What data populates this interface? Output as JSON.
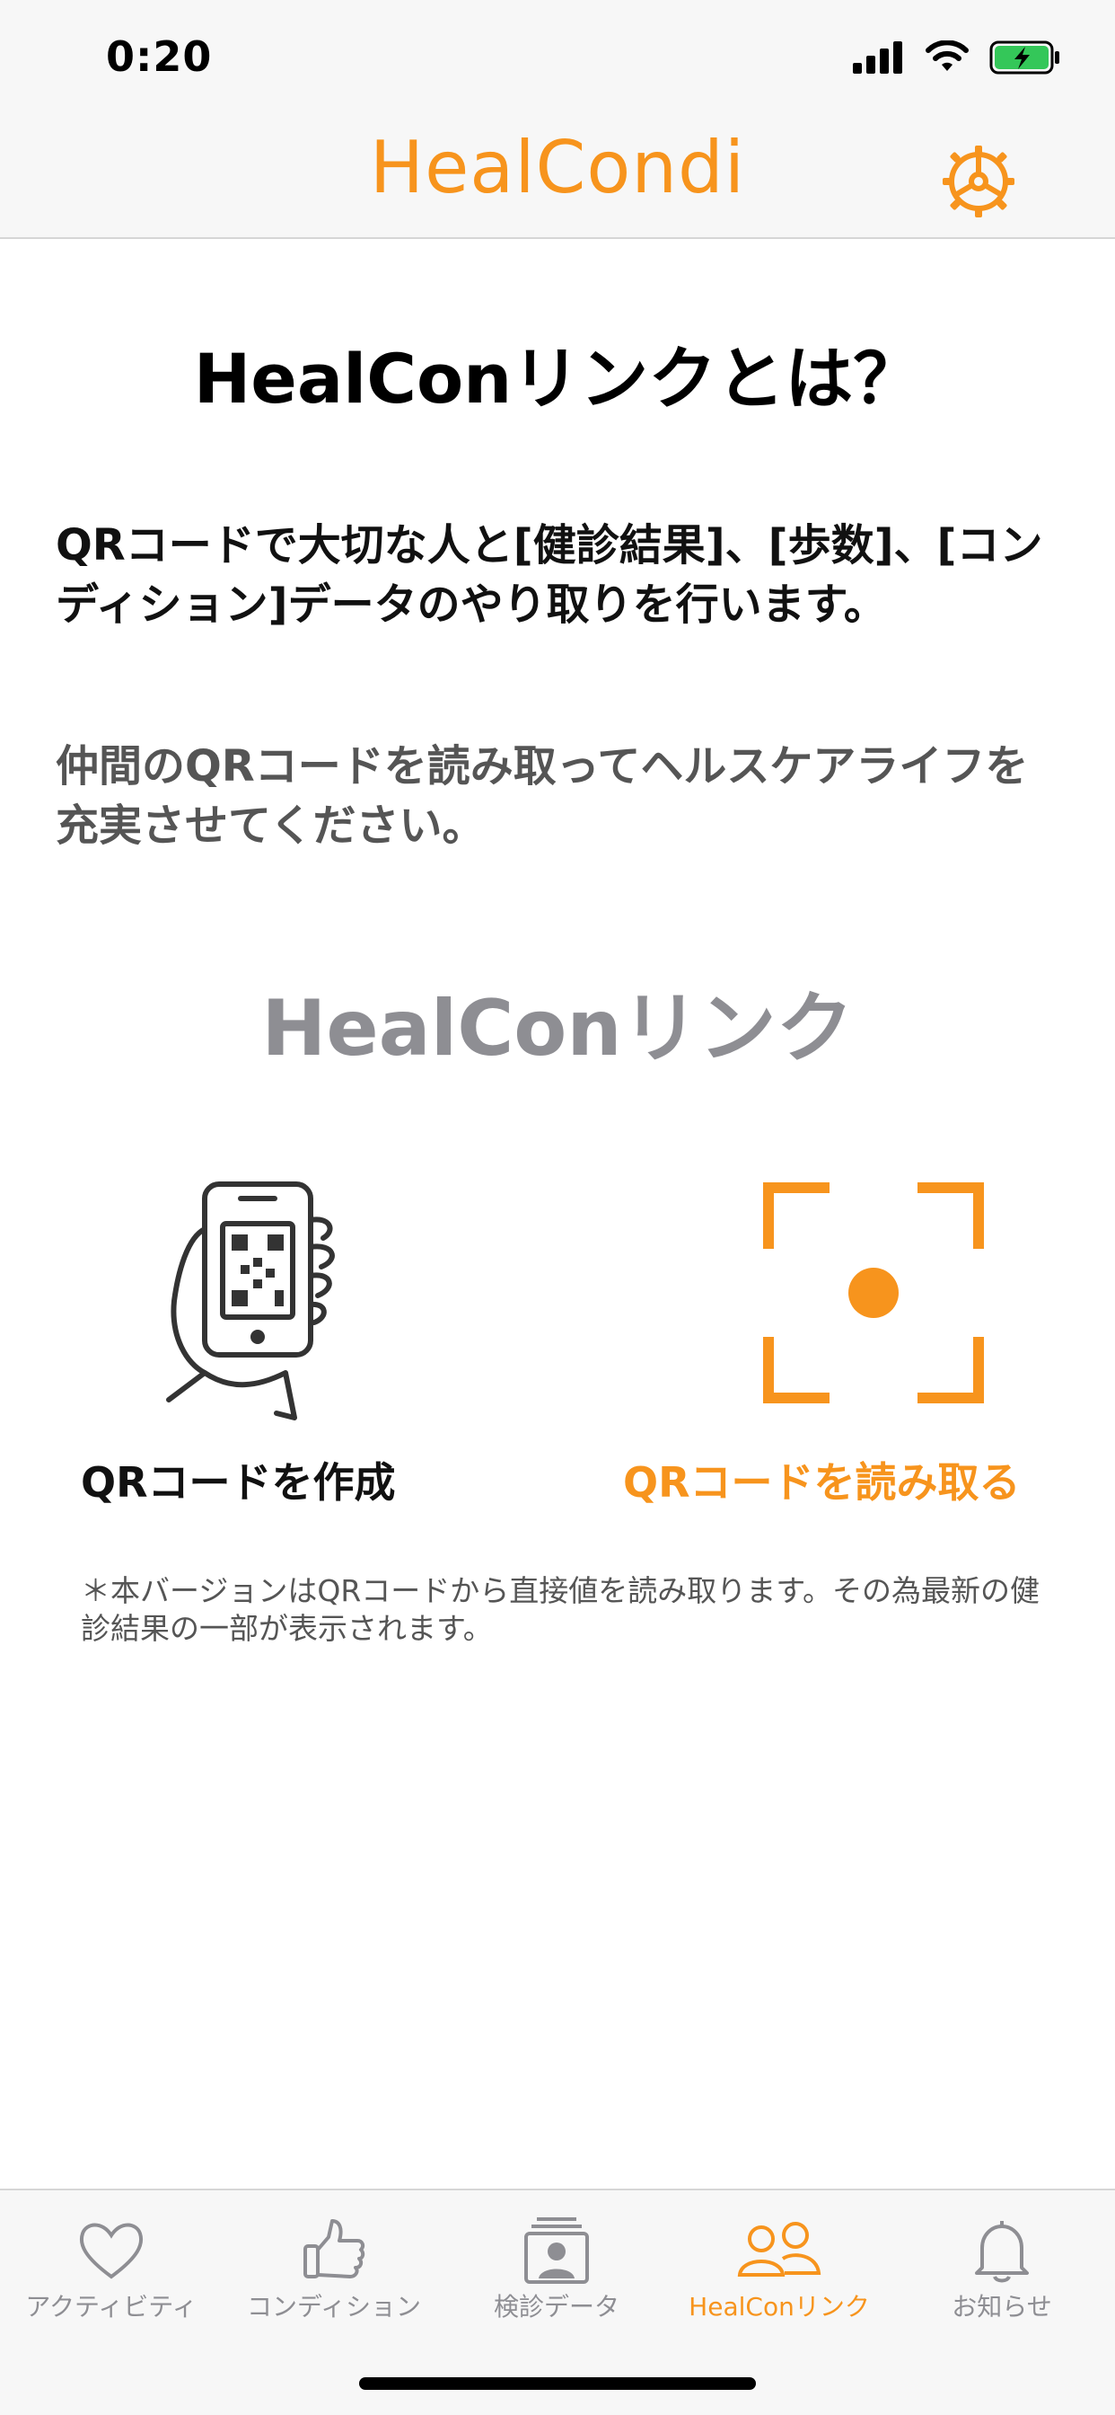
{
  "status_bar": {
    "time": "0:20"
  },
  "nav": {
    "title": "HealCondi"
  },
  "page": {
    "title": "HealConリンクとは？",
    "description": "QRコードで大切な人と[健診結果]、[歩数]、[コンディション]データのやり取りを行います。",
    "sub_description": "仲間のQRコードを読み取ってヘルスケアライフを充実させてください。",
    "section_title": "HealConリンク",
    "create_label": "QRコードを作成",
    "scan_label": "QRコードを読み取る",
    "note": "＊本バージョンはQRコードから直接値を読み取ります。その為最新の健診結果の一部が表示されます。"
  },
  "tabs": [
    {
      "label": "アクティビティ",
      "icon": "heart-icon",
      "active": false
    },
    {
      "label": "コンディション",
      "icon": "thumbs-up-icon",
      "active": false
    },
    {
      "label": "検診データ",
      "icon": "profile-card-icon",
      "active": false
    },
    {
      "label": "HealConリンク",
      "icon": "people-icon",
      "active": true
    },
    {
      "label": "お知らせ",
      "icon": "bell-icon",
      "active": false
    }
  ],
  "colors": {
    "accent": "#f7941d",
    "inactive": "#8e8e93",
    "battery": "#34c759"
  }
}
